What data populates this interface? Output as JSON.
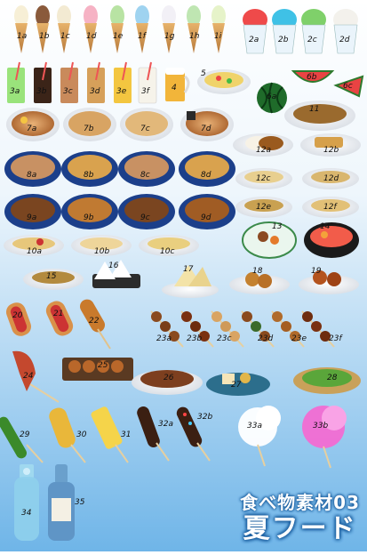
{
  "title": {
    "line1": "食べ物素材03",
    "line2": "夏フード"
  },
  "labels": {
    "cone_1a": "1a",
    "cone_1b": "1b",
    "cone_1c": "1c",
    "cone_1d": "1d",
    "cone_1e": "1e",
    "cone_1f": "1f",
    "cone_1g": "1g",
    "cone_1h": "1h",
    "cone_1i": "1i",
    "ice_2a": "2a",
    "ice_2b": "2b",
    "ice_2c": "2c",
    "ice_2d": "2d",
    "drink_3a": "3a",
    "drink_3b": "3b",
    "drink_3c": "3c",
    "drink_3d": "3d",
    "drink_3e": "3e",
    "drink_3f": "3f",
    "beer_4": "4",
    "hiyashi_5": "5",
    "melon_6a": "6a",
    "melon_6b": "6b",
    "melon_6c": "6c",
    "ramen_7a": "7a",
    "ramen_7b": "7b",
    "ramen_7c": "7c",
    "ramen_7d": "7d",
    "bowl_8a": "8a",
    "bowl_8b": "8b",
    "bowl_8c": "8c",
    "bowl_8d": "8d",
    "bowl_9a": "9a",
    "bowl_9b": "9b",
    "bowl_9c": "9c",
    "bowl_9d": "9d",
    "pasta_10a": "10a",
    "pasta_10b": "10b",
    "pasta_10c": "10c",
    "yakisoba_11": "11",
    "curry_12a": "12a",
    "curry_12b": "12b",
    "plate_12c": "12c",
    "plate_12d": "12d",
    "plate_12e": "12e",
    "plate_12f": "12f",
    "nimono_13": "13",
    "kaisen_14": "14",
    "yakisoba_15": "15",
    "onigiri_16": "16",
    "sandwich_17": "17",
    "karaage_18": "18",
    "karaage_19": "19",
    "hotdog_20": "20",
    "hotdog_21": "21",
    "corndog_22": "22",
    "yakitori_23a": "23a",
    "yakitori_23b": "23b",
    "yakitori_23c": "23c",
    "yakitori_23d": "23d",
    "yakitori_23e": "23e",
    "yakitori_23f": "23f",
    "ika_24": "24",
    "takoyaki_25": "25",
    "okonomi_26": "26",
    "oden_27": "27",
    "edamame_28": "28",
    "kyuri_29": "29",
    "corn_30": "30",
    "pine_31": "31",
    "choco_32a": "32a",
    "choco_32b": "32b",
    "cotton_33a": "33a",
    "cotton_33b": "33b",
    "ramune_34": "34",
    "sake_35": "35"
  },
  "colors": {
    "bg_top": "#ffffff",
    "bg_bottom": "#6fb5e8",
    "title_outline": "#1b5fa0",
    "bowl_blue": "#1c3f8a",
    "broth": "#c8854a",
    "rice": "#f7f2e6"
  }
}
